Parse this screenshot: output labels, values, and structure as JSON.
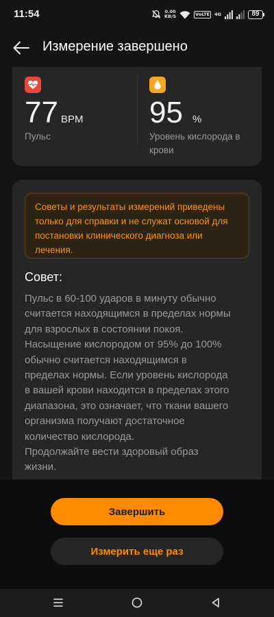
{
  "status_bar": {
    "time": "11:54",
    "speed_value": "0.00",
    "speed_unit": "KB/S",
    "volte": "VoLTE",
    "network": "4G",
    "battery": "89"
  },
  "header": {
    "title": "Измерение завершено"
  },
  "metrics": {
    "pulse": {
      "value": "77",
      "unit": "BPM",
      "label": "Пульс",
      "icon": "heart-pulse-icon",
      "icon_color": "#e8483c"
    },
    "oxygen": {
      "value": "95",
      "unit": "%",
      "label": "Уровень кислорода в крови",
      "icon": "drop-icon",
      "icon_color": "#f5a623"
    }
  },
  "advice": {
    "disclaimer": "Советы и результаты измерений приведены только для справки и не служат основой для постановки клинического диагноза или лечения.",
    "heading": "Совет:",
    "text_lines": [
      "Пульс в 60-100 ударов в минуту обычно",
      "считается находящимся в пределах нормы",
      "для взрослых в состоянии покоя.",
      "Насыщение кислородом от 95% до 100%",
      "обычно считается находящимся в",
      "пределах нормы. Если уровень кислорода",
      "в вашей крови находится в пределах этого",
      "диапазона, это означает, что ткани вашего",
      "организма получают достаточное",
      "количество кислорода.",
      "Продолжайте вести здоровый образ",
      "жизни."
    ]
  },
  "buttons": {
    "finish": "Завершить",
    "measure_again": "Измерить еще раз"
  },
  "colors": {
    "accent": "#ff8a00",
    "card": "#262626",
    "background": "#141414"
  }
}
